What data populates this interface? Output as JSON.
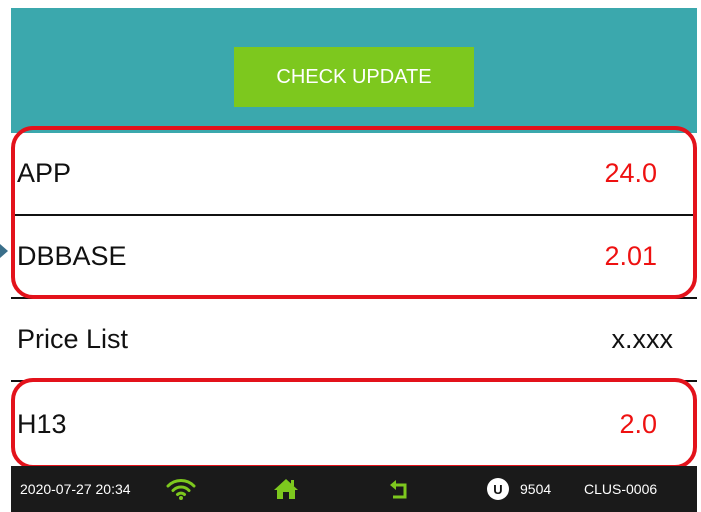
{
  "header": {
    "check_update_label": "CHECK UPDATE"
  },
  "versions": [
    {
      "name": "APP",
      "value": "24.0",
      "highlighted": true
    },
    {
      "name": "DBBASE",
      "value": "2.01",
      "highlighted": true
    },
    {
      "name": "Price List",
      "value": "x.xxx",
      "highlighted": false
    },
    {
      "name": "H13",
      "value": "2.0",
      "highlighted": true
    }
  ],
  "colors": {
    "header_bg": "#3ba8ad",
    "button_bg": "#7dc81e",
    "highlight_border": "#e3121b",
    "value_red": "#ee1111",
    "footer_bg": "#1a1a1a",
    "footer_icon_green": "#7dc81e"
  },
  "status_bar": {
    "datetime": "2020-07-27 20:34",
    "wifi_icon": "wifi-icon",
    "home_icon": "home-icon",
    "back_icon": "back-arrow-icon",
    "user_badge": "U",
    "user_number": "9504",
    "device_serial": "CLUS-0006"
  }
}
